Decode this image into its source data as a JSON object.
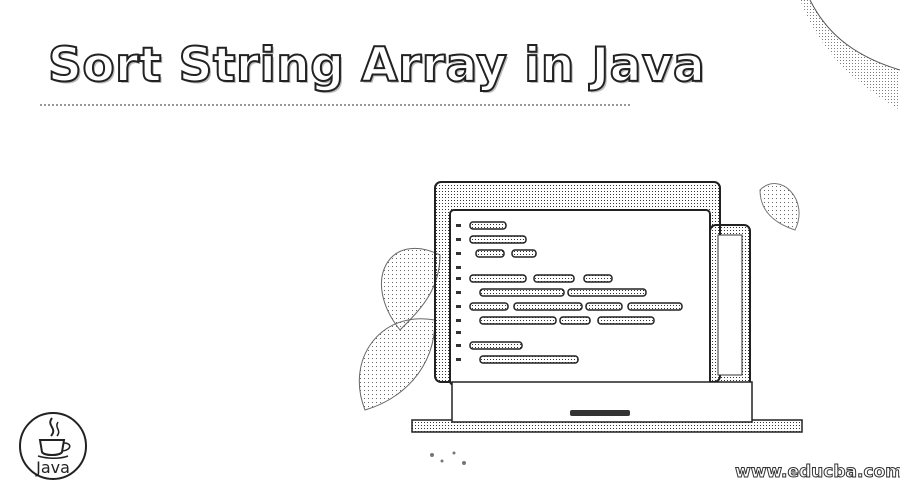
{
  "title": "Sort String Array in Java",
  "logo": {
    "label": "Java",
    "icon": "java-coffee-cup-icon"
  },
  "site": "www.educba.com",
  "colors": {
    "title_fill": "#ffffff",
    "title_stroke": "#222222",
    "dither": "#333333"
  }
}
